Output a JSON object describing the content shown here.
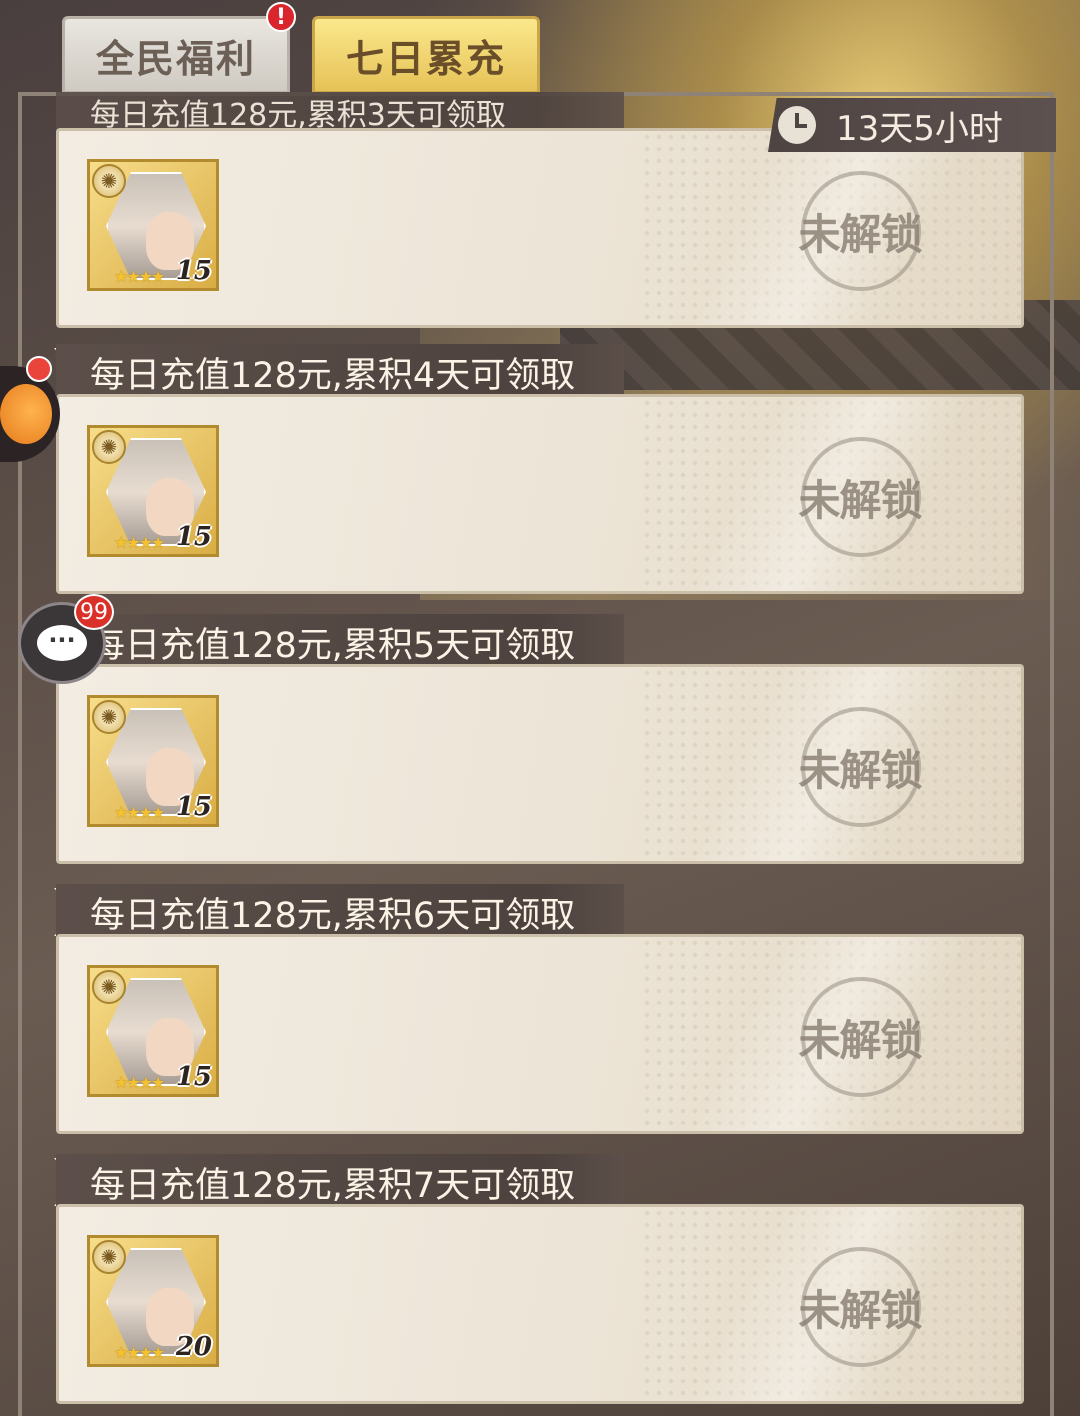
{
  "tabs": [
    {
      "label": "全民福利",
      "active": false,
      "alert": "!"
    },
    {
      "label": "七日累充",
      "active": true
    }
  ],
  "timer": {
    "text": "13天5小时",
    "icon": "clock-icon"
  },
  "rows": [
    {
      "header": "每日充值128元,累积3天可领取",
      "level": "15",
      "stars": "★★★★",
      "status": "未解锁"
    },
    {
      "header": "每日充值128元,累积4天可领取",
      "level": "15",
      "stars": "★★★★",
      "status": "未解锁"
    },
    {
      "header": "每日充值128元,累积5天可领取",
      "level": "15",
      "stars": "★★★★",
      "status": "未解锁"
    },
    {
      "header": "每日充值128元,累积6天可领取",
      "level": "15",
      "stars": "★★★★",
      "status": "未解锁"
    },
    {
      "header": "每日充值128元,累积7天可领取",
      "level": "20",
      "stars": "★★★★",
      "status": "未解锁"
    }
  ],
  "chat": {
    "badge": "99",
    "icon": "chat-icon"
  },
  "colors": {
    "accent_gold": "#e6c257",
    "header_bg": "#4d423e",
    "badge_red": "#d9262c"
  }
}
